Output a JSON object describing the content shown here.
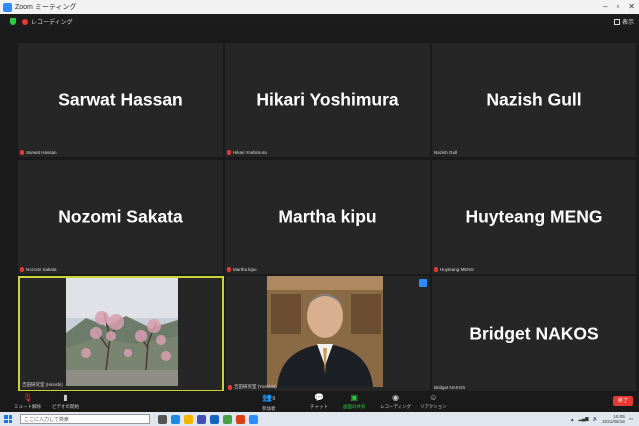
{
  "window": {
    "title": "Zoom ミーティング"
  },
  "topbar": {
    "recording_label": "レコーディング",
    "view_label": "表示"
  },
  "participants": [
    {
      "display": "Sarwat Hassan",
      "label": "Sarwat Hassan",
      "muted": true,
      "video": false
    },
    {
      "display": "Hikari Yoshimura",
      "label": "Hikari Yoshimura",
      "muted": true,
      "video": false
    },
    {
      "display": "Nazish Gull",
      "label": "Nazish Gull",
      "muted": false,
      "video": false
    },
    {
      "display": "Nozomi Sakata",
      "label": "Nozomi Sakata",
      "muted": true,
      "video": false
    },
    {
      "display": "Martha kipu",
      "label": "Martha kipu",
      "muted": true,
      "video": false
    },
    {
      "display": "Huyteang MENG",
      "label": "Huyteang MENG",
      "muted": true,
      "video": false
    },
    {
      "display": "",
      "label": "吉田研究室 (Hiroshi)",
      "muted": false,
      "video": true,
      "active_speaker": true
    },
    {
      "display": "",
      "label": "吉田研究室 (Yoshida)",
      "muted": true,
      "video": true
    },
    {
      "display": "Bridget NAKOS",
      "label": "Bridget NAKOS",
      "muted": false,
      "video": false
    }
  ],
  "toolbar": {
    "mute": "ミュート解除",
    "video": "ビデオの開始",
    "participants": "参加者",
    "participants_count": "9",
    "chat": "チャット",
    "share": "画面の共有",
    "record": "レコーディング",
    "reactions": "リアクション",
    "end": "終了"
  },
  "taskbar": {
    "search_placeholder": "ここに入力して検索",
    "time": "15:05",
    "date": "2021/06/18"
  },
  "colors": {
    "active_border": "#c9d43a",
    "end_red": "#e53935",
    "share_green": "#2ecc40",
    "zoom_blue": "#2d8cff"
  }
}
